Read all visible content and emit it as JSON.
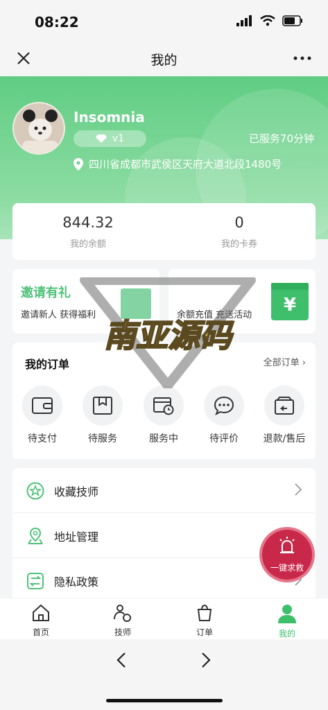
{
  "status_bar": {
    "time": "08:22"
  },
  "nav": {
    "title": "我的"
  },
  "profile": {
    "username": "Insomnia",
    "level": "v1",
    "served": "已服务70分钟",
    "location": "四川省成都市武侯区天府大道北段1480号"
  },
  "balance": {
    "amount_value": "844.32",
    "amount_label": "我的余额",
    "coupons_value": "0",
    "coupons_label": "我的卡券"
  },
  "promos": {
    "invite": {
      "title": "邀请有礼",
      "subtitle": "邀请新人 获得福利"
    },
    "recharge": {
      "subtitle": "余额充值 充送活动",
      "icon_text": "¥"
    }
  },
  "orders": {
    "title": "我的订单",
    "all_label": "全部订单",
    "items": [
      {
        "label": "待支付",
        "icon": "wallet-icon"
      },
      {
        "label": "待服务",
        "icon": "bookmark-box-icon"
      },
      {
        "label": "服务中",
        "icon": "calendar-clock-icon"
      },
      {
        "label": "待评价",
        "icon": "chat-bubble-icon"
      },
      {
        "label": "退款/售后",
        "icon": "return-box-icon"
      }
    ]
  },
  "menu": {
    "items": [
      {
        "label": "收藏技师",
        "icon": "star-circle-icon"
      },
      {
        "label": "地址管理",
        "icon": "map-pin-icon"
      },
      {
        "label": "隐私政策",
        "icon": "policy-icon"
      }
    ]
  },
  "sos": {
    "label": "一键求救"
  },
  "tabbar": {
    "items": [
      {
        "label": "首页"
      },
      {
        "label": "技师"
      },
      {
        "label": "订单"
      },
      {
        "label": "我的"
      }
    ]
  },
  "watermark": {
    "text": "南亚源码"
  },
  "colors": {
    "accent": "#4fc27a",
    "sos": "#c8294a"
  }
}
